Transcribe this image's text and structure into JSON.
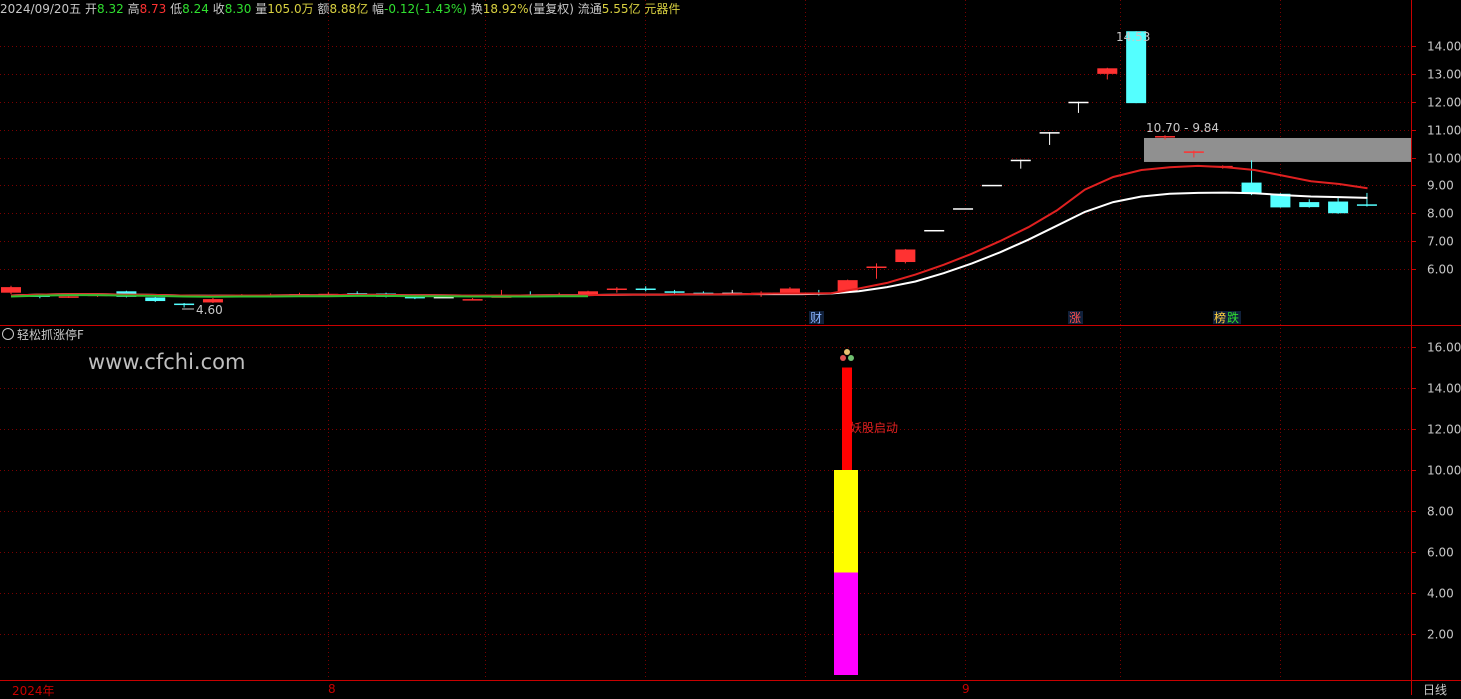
{
  "header": {
    "date": "2024/09/20五",
    "open_label": "开",
    "open_value": "8.32",
    "high_label": "高",
    "high_value": "8.73",
    "low_label": "低",
    "low_value": "8.24",
    "close_label": "收",
    "close_value": "8.30",
    "volume_label": "量",
    "volume_value": "105.0万",
    "amount_label": "额",
    "amount_value": "8.88亿",
    "change_label": "幅",
    "change_value": "-0.12(-1.43%)",
    "turnover_label": "换",
    "turnover_value": "18.92%",
    "adjust": "(量复权)",
    "float_label": "流通",
    "float_value": "5.55亿",
    "sector": "元器件"
  },
  "colors": {
    "up": "#ff3232",
    "down": "#54ffff",
    "flat": "#ffffff",
    "grid": "#7a0000",
    "axis": "#c80000",
    "ma_fast": "#e02020",
    "ma_slow": "#ffffff",
    "zone": "#909090",
    "bar_red": "#ff0000",
    "bar_yellow": "#ffff00",
    "bar_magenta": "#ff00ff",
    "label_yellow": "#d8d040",
    "label_green": "#30e030",
    "label_red": "#ff3232"
  },
  "indicator": {
    "title": "轻松抓涨停F",
    "watermark": "www.cfchi.com",
    "signal_text": "妖股启动",
    "signal_icon": "signal-icon"
  },
  "markers": {
    "fin": "财",
    "zhang": "涨",
    "bang": "榜",
    "die": "跌"
  },
  "x_axis": {
    "year": "2024年",
    "aug": "8",
    "sep": "9",
    "period": "日线"
  },
  "chart_data": [
    {
      "type": "candlestick",
      "title": "",
      "ylim": [
        4.0,
        15.0
      ],
      "y_ticks": [
        "14.00",
        "13.00",
        "12.00",
        "11.00",
        "10.00",
        "9.00",
        "8.00",
        "7.00",
        "6.00"
      ],
      "annotations": {
        "high_label": "14.53",
        "low_label": "4.60",
        "zone_label": "10.70 - 9.84",
        "zone_range": [
          9.84,
          10.7
        ]
      },
      "candles": [
        [
          5.15,
          5.35,
          5.4,
          5.1
        ],
        [
          5.05,
          5.0,
          5.1,
          4.95
        ],
        [
          5.0,
          5.02,
          5.08,
          4.96
        ],
        [
          5.05,
          5.08,
          5.12,
          5.0
        ],
        [
          5.2,
          5.0,
          5.22,
          4.98
        ],
        [
          4.98,
          4.85,
          5.0,
          4.82
        ],
        [
          4.76,
          4.74,
          4.78,
          4.62
        ],
        [
          4.8,
          4.92,
          4.96,
          4.78
        ],
        [
          5.05,
          5.06,
          5.1,
          5.0
        ],
        [
          5.05,
          5.07,
          5.12,
          5.02
        ],
        [
          5.08,
          5.1,
          5.15,
          5.05
        ],
        [
          5.1,
          5.11,
          5.18,
          5.08
        ],
        [
          5.13,
          5.12,
          5.2,
          5.08
        ],
        [
          5.12,
          5.0,
          5.15,
          4.98
        ],
        [
          5.0,
          4.98,
          5.05,
          4.92
        ],
        [
          5.0,
          5.0,
          5.05,
          4.96
        ],
        [
          4.9,
          4.92,
          4.96,
          4.88
        ],
        [
          5.0,
          5.02,
          5.25,
          4.98
        ],
        [
          5.05,
          5.04,
          5.2,
          5.0
        ],
        [
          5.05,
          5.06,
          5.15,
          5.0
        ],
        [
          5.1,
          5.2,
          5.22,
          5.08
        ],
        [
          5.25,
          5.3,
          5.35,
          5.15
        ],
        [
          5.3,
          5.28,
          5.38,
          5.2
        ],
        [
          5.2,
          5.18,
          5.25,
          5.12
        ],
        [
          5.15,
          5.12,
          5.2,
          5.1
        ],
        [
          5.15,
          5.15,
          5.25,
          5.08
        ],
        [
          5.1,
          5.15,
          5.2,
          5.0
        ],
        [
          5.15,
          5.3,
          5.35,
          5.1
        ],
        [
          5.15,
          5.12,
          5.25,
          5.05
        ],
        [
          5.2,
          5.6,
          5.62,
          5.15
        ],
        [
          6.05,
          6.09,
          6.2,
          5.65
        ],
        [
          6.25,
          6.7,
          6.72,
          6.2
        ],
        [
          7.4,
          7.4,
          7.4,
          7.4
        ],
        [
          8.18,
          8.18,
          8.18,
          8.18
        ],
        [
          9.02,
          9.02,
          9.02,
          9.02
        ],
        [
          9.92,
          9.92,
          9.92,
          9.6
        ],
        [
          10.91,
          10.91,
          10.91,
          10.45
        ],
        [
          12.0,
          12.0,
          12.0,
          11.6
        ],
        [
          13.0,
          13.2,
          13.22,
          12.8
        ],
        [
          14.53,
          11.95,
          14.53,
          11.95
        ],
        [
          10.75,
          10.77,
          10.8,
          10.65
        ],
        [
          10.2,
          10.22,
          10.25,
          10.0
        ],
        [
          9.68,
          9.7,
          9.72,
          9.6
        ],
        [
          9.1,
          8.7,
          9.9,
          8.65
        ],
        [
          8.7,
          8.21,
          8.72,
          8.2
        ],
        [
          8.4,
          8.22,
          8.5,
          8.2
        ],
        [
          8.42,
          8.0,
          8.55,
          7.98
        ],
        [
          8.32,
          8.3,
          8.73,
          8.24
        ]
      ],
      "ma_fast": [
        5.05,
        5.08,
        5.1,
        5.1,
        5.08,
        5.07,
        5.05,
        5.04,
        5.05,
        5.05,
        5.06,
        5.06,
        5.07,
        5.07,
        5.06,
        5.06,
        5.05,
        5.05,
        5.05,
        5.06,
        5.06,
        5.07,
        5.08,
        5.08,
        5.09,
        5.09,
        5.1,
        5.12,
        5.12,
        5.13,
        5.3,
        5.5,
        5.8,
        6.15,
        6.55,
        7.0,
        7.5,
        8.1,
        8.85,
        9.3,
        9.55,
        9.65,
        9.7,
        9.65,
        9.55,
        9.35,
        9.15,
        9.05,
        8.9
      ],
      "ma_slow": [
        5.05,
        5.08,
        5.1,
        5.1,
        5.08,
        5.07,
        5.05,
        5.04,
        5.05,
        5.05,
        5.06,
        5.06,
        5.07,
        5.07,
        5.06,
        5.06,
        5.05,
        5.05,
        5.05,
        5.06,
        5.06,
        5.07,
        5.08,
        5.08,
        5.09,
        5.09,
        5.1,
        5.1,
        5.1,
        5.12,
        5.2,
        5.35,
        5.55,
        5.85,
        6.2,
        6.6,
        7.05,
        7.55,
        8.05,
        8.4,
        8.6,
        8.7,
        8.73,
        8.74,
        8.72,
        8.65,
        8.6,
        8.58,
        8.55
      ]
    },
    {
      "type": "bar",
      "title": "轻松抓涨停F",
      "ylim": [
        0,
        16
      ],
      "y_ticks": [
        "16.00",
        "14.00",
        "12.00",
        "10.00",
        "8.00",
        "6.00",
        "4.00",
        "2.00"
      ],
      "stacked_bar": {
        "segments": [
          {
            "from": 0,
            "to": 5,
            "color_key": "bar_magenta"
          },
          {
            "from": 5,
            "to": 10,
            "color_key": "bar_yellow"
          },
          {
            "from": 10,
            "to": 15,
            "color_key": "bar_red"
          }
        ]
      }
    }
  ]
}
